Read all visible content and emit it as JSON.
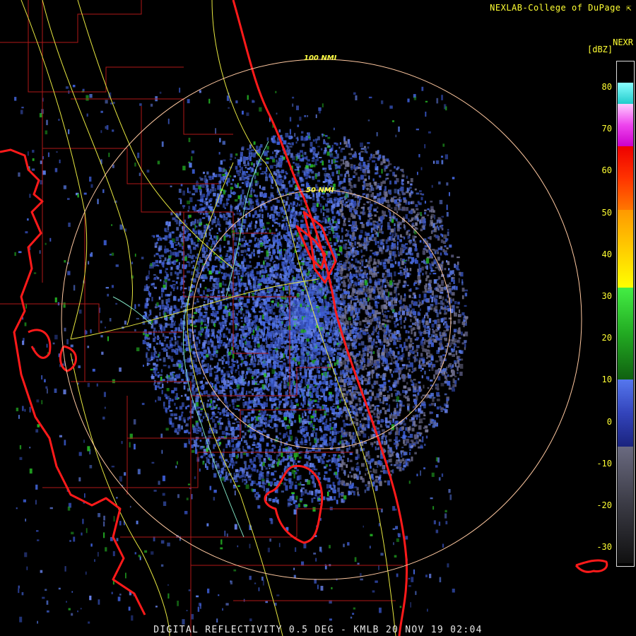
{
  "header": {
    "credit": "NEXLAB-College of DuPage",
    "credit_icon": "cursor-arrow-icon"
  },
  "legend": {
    "product": "NEXR",
    "units": "[dBZ]",
    "ticks": [
      "80",
      "70",
      "60",
      "50",
      "40",
      "30",
      "20",
      "10",
      "0",
      "-10",
      "-20",
      "-30"
    ]
  },
  "range_rings": [
    {
      "label": "100 NMI",
      "range_nmi": 100
    },
    {
      "label": "50 NMI",
      "range_nmi": 50
    }
  ],
  "footer": {
    "caption": "DIGITAL REFLECTIVITY 0.5 DEG - KMLB 20 NOV 19 02:04"
  },
  "colors": {
    "background": "#000000",
    "coastline": "#ff1111",
    "county_lines": "#aa1111",
    "highways": "#ffff44",
    "rivers": "#7fe0c0",
    "range_rings": "#ffc8a0",
    "echo_light": "#4466dd",
    "echo_moderate": "#22aa22"
  }
}
